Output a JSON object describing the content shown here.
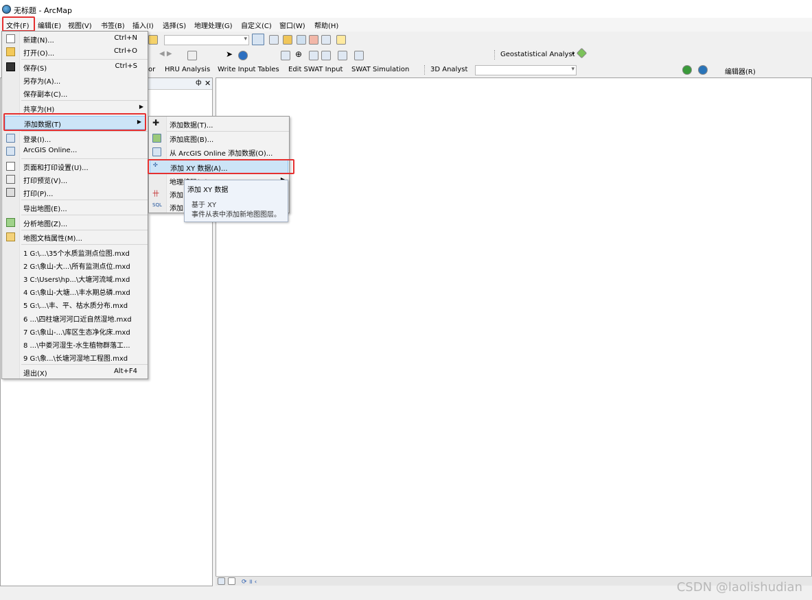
{
  "window": {
    "title": "无标题 - ArcMap"
  },
  "menubar": [
    "文件(F)",
    "编辑(E)",
    "视图(V)",
    "书签(B)",
    "插入(I)",
    "选择(S)",
    "地理处理(G)",
    "自定义(C)",
    "窗口(W)",
    "帮助(H)"
  ],
  "toolbars": {
    "geostat": "Geostatistical Analyst",
    "row3": [
      "or",
      "HRU Analysis",
      "Write Input Tables",
      "Edit SWAT Input",
      "SWAT Simulation",
      "3D Analyst",
      "编辑器(R)"
    ]
  },
  "file_menu": {
    "items": [
      {
        "label": "新建(N)...",
        "shortcut": "Ctrl+N"
      },
      {
        "label": "打开(O)...",
        "shortcut": "Ctrl+O"
      },
      {
        "label": "保存(S)",
        "shortcut": "Ctrl+S"
      },
      {
        "label": "另存为(A)..."
      },
      {
        "label": "保存副本(C)..."
      },
      {
        "label": "共享为(H)"
      },
      {
        "label": "添加数据(T)"
      },
      {
        "label": "登录(I)..."
      },
      {
        "label": "ArcGIS Online..."
      },
      {
        "label": "页面和打印设置(U)..."
      },
      {
        "label": "打印预览(V)..."
      },
      {
        "label": "打印(P)..."
      },
      {
        "label": "导出地图(E)..."
      },
      {
        "label": "分析地图(Z)..."
      },
      {
        "label": "地图文档属性(M)..."
      },
      {
        "label": "1 G:\\...\\35个水质监测点位图.mxd"
      },
      {
        "label": "2 G:\\象山-大...\\所有监测点位.mxd"
      },
      {
        "label": "3 C:\\Users\\hp...\\大塘河流域.mxd"
      },
      {
        "label": "4 G:\\象山-大塘...\\丰水期总磷.mxd"
      },
      {
        "label": "5 G:\\...\\丰、平、枯水质分布.mxd"
      },
      {
        "label": "6 ...\\四柱塘河河口近自然湿地.mxd"
      },
      {
        "label": "7 G:\\象山-...\\库区生态净化床.mxd"
      },
      {
        "label": "8 ...\\中娄河湿生-水生植物群落工..."
      },
      {
        "label": "9 G:\\象...\\长塘河湿地工程图.mxd"
      },
      {
        "label": "退出(X)",
        "shortcut": "Alt+F4"
      }
    ]
  },
  "add_data_submenu": {
    "items": [
      "添加数据(T)...",
      "添加底图(B)...",
      "从 ArcGIS Online 添加数据(O)...",
      "添加 XY 数据(A)...",
      "地理编码(D)",
      "添加",
      "添加"
    ]
  },
  "tooltip": {
    "title": "添加 XY 数据",
    "line1": "基于 XY",
    "line2": "事件从表中添加新地图图层。"
  },
  "watermark": "CSDN @laolishudian",
  "colors": {
    "highlight": "#cce4f7",
    "red_annotation": "#e53030"
  }
}
